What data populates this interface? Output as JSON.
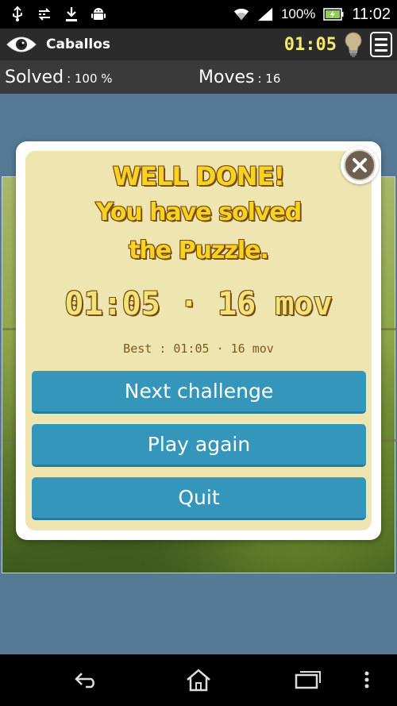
{
  "status_bar": {
    "battery_text": "100%",
    "time": "11:02",
    "icons": [
      "usb-icon",
      "sync-icon",
      "download-icon",
      "android-icon",
      "wifi-icon",
      "signal-icon",
      "battery-icon"
    ]
  },
  "header": {
    "title": "Caballos",
    "timer": "01:05",
    "icons": [
      "eye-icon",
      "lightbulb-icon",
      "menu-icon"
    ]
  },
  "stats": {
    "solved_label": "Solved",
    "solved_value": ": 100 %",
    "moves_label": "Moves",
    "moves_value": ": 16"
  },
  "dialog": {
    "line1": "WELL DONE!",
    "line2": "You have solved",
    "line3": "the Puzzle.",
    "result": "01:05 · 16 mov",
    "best": "Best : 01:05 · 16 mov",
    "buttons": {
      "next": "Next challenge",
      "again": "Play again",
      "quit": "Quit"
    }
  },
  "nav": {
    "icons": [
      "back-icon",
      "home-icon",
      "recents-icon",
      "overflow-icon"
    ]
  },
  "colors": {
    "accent_button": "#3596bc",
    "dialog_bg": "#efe5b0",
    "title_yellow": "#f7d321",
    "timer_yellow": "#f5e96a",
    "game_bg": "#567a96"
  }
}
